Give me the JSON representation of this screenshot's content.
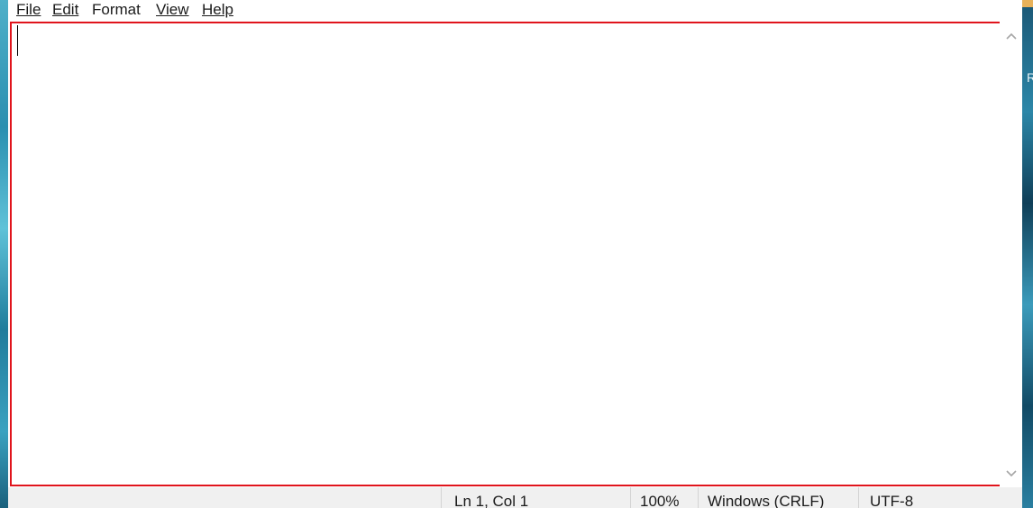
{
  "menu": {
    "file": "File",
    "edit": "Edit",
    "format": "Format",
    "view": "View",
    "help": "Help"
  },
  "editor": {
    "content": ""
  },
  "status": {
    "position": "Ln 1, Col 1",
    "zoom": "100%",
    "line_ending": "Windows (CRLF)",
    "encoding": "UTF-8"
  },
  "wallpaper": {
    "right_glyph": "R"
  },
  "colors": {
    "highlight_border": "#e0141c",
    "statusbar_bg": "#f0f0f0"
  },
  "icons": {
    "scroll_up": "chevron-up-icon",
    "scroll_down": "chevron-down-icon"
  }
}
